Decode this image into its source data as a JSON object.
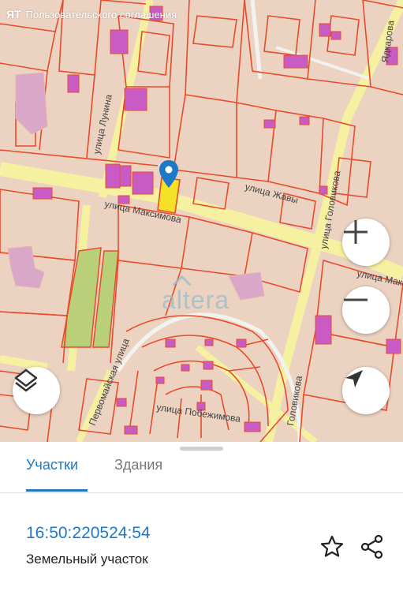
{
  "map": {
    "attribution": "Пользовательского соглашения",
    "attribution_logo": "Я",
    "attribution_prefix": "Т",
    "streets": {
      "maksimova": "улица Максимова",
      "maksimova2": "улица Макси",
      "golovikova": "улица Головикова",
      "golovikova2": "Головикова",
      "pobezhimova": "улица Побежимова",
      "lunina": "улица Лунина",
      "yadkarova": "Ядкарова",
      "zhavy": "улица Жавы",
      "pervomaiskaya": "Первомайская улица"
    },
    "watermark": "altera",
    "buttons": {
      "zoom_in": "plus-icon",
      "zoom_out": "minus-icon",
      "layers": "layers-icon",
      "locate": "navigation-arrow-icon"
    },
    "colors": {
      "parcel_border": "#e84b2a",
      "parcel_fill": "#ecd2c1",
      "building": "#c95bc5",
      "road": "#f6f1a0",
      "green": "#b9cf78",
      "selected": "#f5e12a",
      "marker": "#1e78c8"
    }
  },
  "panel": {
    "tabs": [
      "Участки",
      "Здания"
    ],
    "active_tab": "Участки",
    "cadastral_number": "16:50:220524:54",
    "object_type": "Земельный участок",
    "actions": [
      "star-icon",
      "share-icon"
    ]
  }
}
